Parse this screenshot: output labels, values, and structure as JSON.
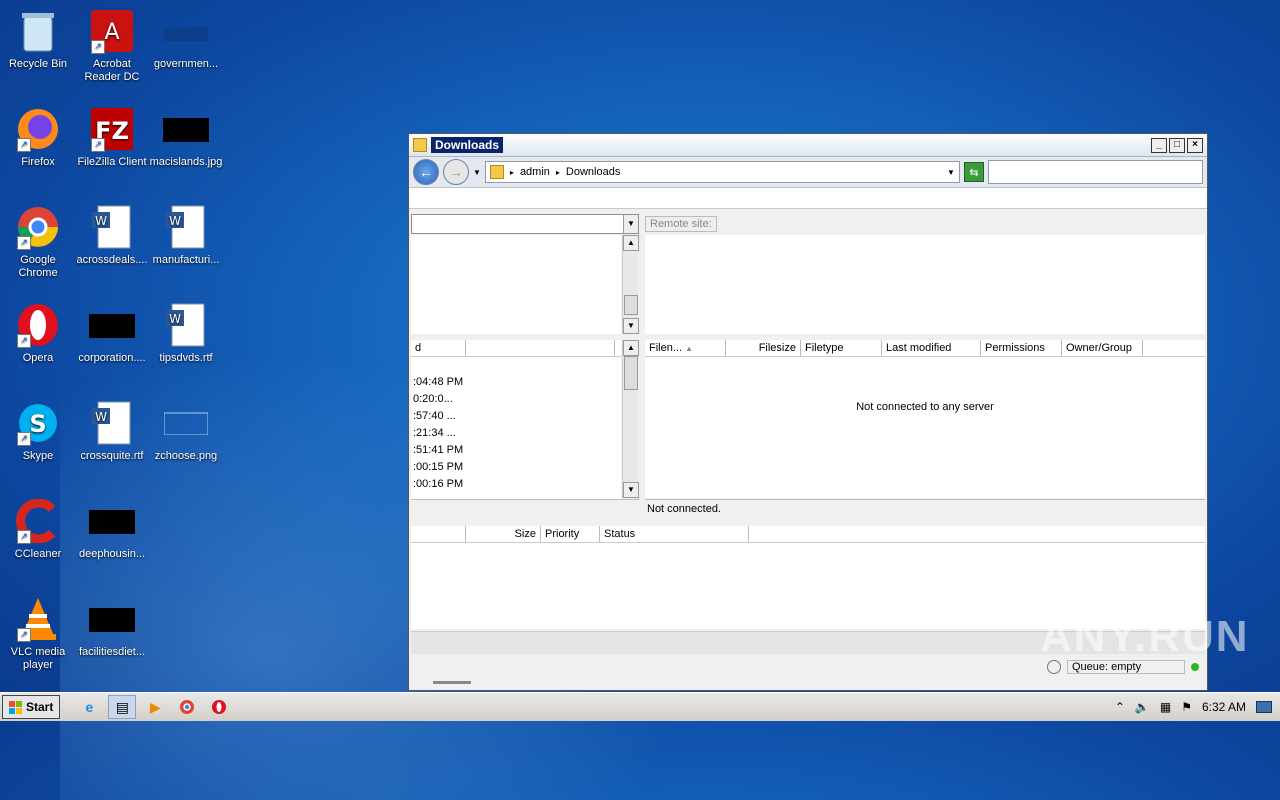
{
  "desktop": {
    "icons": [
      {
        "label": "Recycle Bin",
        "icon": "recycle-bin-icon"
      },
      {
        "label": "Acrobat Reader DC",
        "icon": "acrobat-icon"
      },
      {
        "label": "governmen...",
        "icon": "image-file-icon"
      },
      {
        "label": "Firefox",
        "icon": "firefox-icon"
      },
      {
        "label": "FileZilla Client",
        "icon": "filezilla-icon"
      },
      {
        "label": "macislands.jpg",
        "icon": "image-file-icon"
      },
      {
        "label": "Google Chrome",
        "icon": "chrome-icon"
      },
      {
        "label": "acrossdeals....",
        "icon": "word-doc-icon"
      },
      {
        "label": "manufacturi...",
        "icon": "word-doc-icon"
      },
      {
        "label": "Opera",
        "icon": "opera-icon"
      },
      {
        "label": "corporation....",
        "icon": "image-file-icon"
      },
      {
        "label": "tipsdvds.rtf",
        "icon": "word-doc-icon"
      },
      {
        "label": "Skype",
        "icon": "skype-icon"
      },
      {
        "label": "crossquite.rtf",
        "icon": "word-doc-icon"
      },
      {
        "label": "zchoose.png",
        "icon": "image-file-icon"
      },
      {
        "label": "CCleaner",
        "icon": "ccleaner-icon"
      },
      {
        "label": "deephousin...",
        "icon": "image-file-icon"
      },
      {
        "label": "VLC media player",
        "icon": "vlc-icon"
      },
      {
        "label": "facilitiesdiet...",
        "icon": "image-file-icon"
      }
    ]
  },
  "window": {
    "title": "Downloads",
    "breadcrumb": [
      "admin",
      "Downloads"
    ],
    "remote_site_label": "Remote site:",
    "local_rows": [
      ":04:48 PM",
      "0:20:0...",
      ":57:40 ...",
      ":21:34 ...",
      ":51:41 PM",
      ":00:15 PM",
      ":00:16 PM"
    ],
    "local_header_cut": "d",
    "remote_headers": [
      "Filen...",
      "Filesize",
      "Filetype",
      "Last modified",
      "Permissions",
      "Owner/Group"
    ],
    "not_connected_msg": "Not connected to any server",
    "remote_status": "Not connected.",
    "queue_headers": [
      "Size",
      "Priority",
      "Status"
    ],
    "queue_status": "Queue: empty"
  },
  "taskbar": {
    "start_label": "Start",
    "clock": "6:32 AM"
  },
  "watermark": "ANY.RUN"
}
